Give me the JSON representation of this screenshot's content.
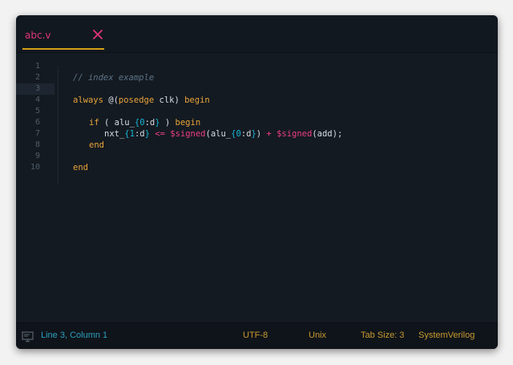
{
  "tab": {
    "filename": "abc.v"
  },
  "line_numbers": [
    "1",
    "2",
    "3",
    "4",
    "5",
    "6",
    "7",
    "8",
    "9",
    "10"
  ],
  "code": {
    "line2_comment": "// index example",
    "line4_kw_always": "always",
    "line4_at": " @(",
    "line4_kw_posedge": "posedge",
    "line4_clk": " clk) ",
    "line4_kw_begin": "begin",
    "line6_kw_if": "if",
    "line6_open": " ( alu_",
    "line6_brace_open": "{",
    "line6_zero": "0",
    "line6_d": ":d",
    "line6_brace_close": "}",
    "line6_close": " ) ",
    "line6_kw_begin": "begin",
    "line7_nxt": "nxt_",
    "line7_brace_open": "{",
    "line7_one": "1",
    "line7_d": ":d",
    "line7_brace_close": "}",
    "line7_sp1": " ",
    "line7_le": "<=",
    "line7_sp2": " ",
    "line7_signed1": "$signed",
    "line7_alu": "(alu_",
    "line7_brace2_open": "{",
    "line7_zero": "0",
    "line7_d2": ":d",
    "line7_brace2_close": "}",
    "line7_paren": ") ",
    "line7_plus": "+",
    "line7_sp3": " ",
    "line7_signed2": "$signed",
    "line7_add": "(add);",
    "line8_kw_end": "end",
    "line10_kw_end": "end"
  },
  "status": {
    "position": "Line 3, Column 1",
    "encoding": "UTF-8",
    "line_endings": "Unix",
    "tab_size": "Tab Size: 3",
    "language": "SystemVerilog"
  },
  "colors": {
    "background": "#141a21",
    "tab_label": "#e0357c",
    "tab_underline": "#d4a017",
    "keyword": "#e8a33a",
    "number": "#16b6d6",
    "operator": "#ec3e86",
    "comment": "#5d7488",
    "status_position": "#2d9fc0",
    "status_item": "#c79a2e"
  },
  "icons": {
    "tab_close": "close-icon",
    "status": "monitor-icon"
  }
}
